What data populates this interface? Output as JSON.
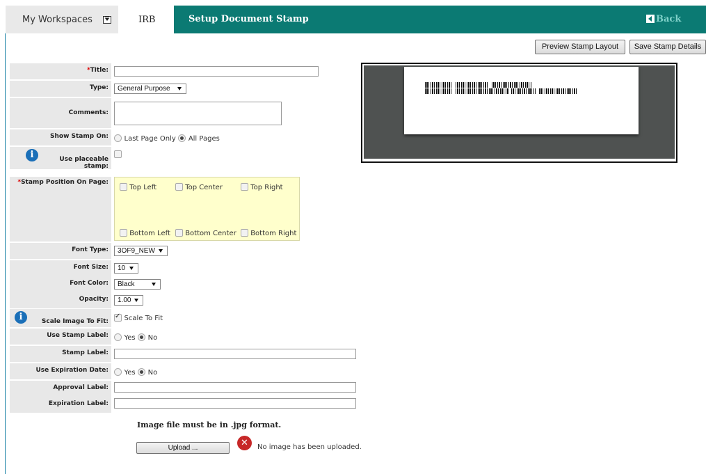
{
  "nav": {
    "workspaces": "My Workspaces",
    "irb": "IRB",
    "page_title": "Setup Document Stamp",
    "back": "Back"
  },
  "toolbar": {
    "preview": "Preview Stamp Layout",
    "save": "Save Stamp Details"
  },
  "form": {
    "title": {
      "required": "*",
      "label": "Title:",
      "value": ""
    },
    "type": {
      "label": "Type:",
      "value": "General Purpose"
    },
    "comments": {
      "label": "Comments:",
      "value": ""
    },
    "show_stamp_on": {
      "label": "Show Stamp On:",
      "options": [
        "Last Page Only",
        "All Pages"
      ],
      "selected": "All Pages"
    },
    "placeable": {
      "label_line1": "Use placeable",
      "label_line2": "stamp:",
      "checked": false
    },
    "stamp_position": {
      "required": "*",
      "label": "Stamp Position On Page:",
      "options": [
        "Top Left",
        "Top Center",
        "Top Right",
        "Bottom Left",
        "Bottom Center",
        "Bottom Right"
      ]
    },
    "font_type": {
      "label": "Font Type:",
      "value": "3OF9_NEW"
    },
    "font_size": {
      "label": "Font Size:",
      "value": "10"
    },
    "font_color": {
      "label": "Font Color:",
      "value": "Black"
    },
    "opacity": {
      "label": "Opacity:",
      "value": "1.00"
    },
    "scale": {
      "label": "Scale Image To Fit:",
      "option": "Scale To Fit",
      "checked": true
    },
    "use_stamp_label": {
      "label": "Use Stamp Label:",
      "options": [
        "Yes",
        "No"
      ],
      "selected": "No"
    },
    "stamp_label": {
      "label": "Stamp Label:",
      "value": ""
    },
    "use_expiration": {
      "label": "Use Expiration Date:",
      "options": [
        "Yes",
        "No"
      ],
      "selected": "No"
    },
    "approval_label": {
      "label": "Approval Label:",
      "value": ""
    },
    "expiration_label": {
      "label": "Expiration Label:",
      "value": ""
    }
  },
  "upload": {
    "note": "Image file must be in .jpg format.",
    "button": "Upload ...",
    "status": "No image has been uploaded."
  },
  "colors": {
    "nav_teal": "#0b7a73",
    "label_bg": "#e8e8e8",
    "position_bg": "#ffffcc",
    "info_blue": "#1a6fb8",
    "error_red": "#c72828"
  }
}
